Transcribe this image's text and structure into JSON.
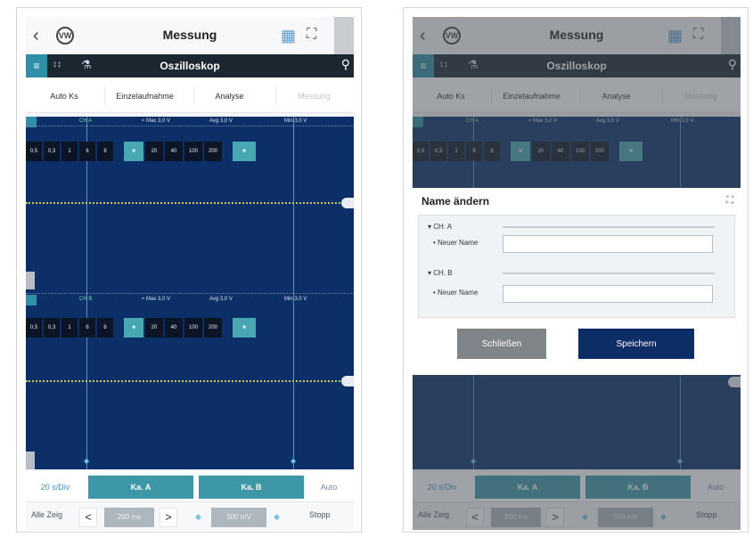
{
  "title": "Messung",
  "toolbar": {
    "title": "Oszilloskop",
    "mode_label": "↕↕",
    "menu_icon": "flask-icon",
    "search_icon": "search-icon"
  },
  "function_tabs": [
    {
      "label": "Auto Ks",
      "enabled": true
    },
    {
      "label": "Einzelaufnahme",
      "enabled": true
    },
    {
      "label": "Analyse",
      "enabled": true
    },
    {
      "label": "Messung",
      "enabled": false
    }
  ],
  "scope": {
    "header_labels": [
      "CH A",
      "≈ Max 3,0 V",
      "Avg 3,0 V",
      "Min 3,0 V"
    ],
    "range_buttons": [
      "0,5",
      "0,3",
      "1",
      "6",
      "8",
      "■",
      "20",
      "40",
      "100",
      "200",
      "■"
    ],
    "header_labels_b": [
      "CH B",
      "≈ Max 3,0 V",
      "Avg 3,0 V",
      "Min 3,0 V"
    ]
  },
  "channel_row": {
    "time_label": "20 s/Div",
    "ch_a": "Ka. A",
    "ch_b": "Ka. B",
    "auto": "Auto"
  },
  "bottom_row": {
    "all_show": "Alle Zeig",
    "prev": "<",
    "next": ">",
    "value_a": "200 ms",
    "value_b": "500 mV",
    "stop": "Stopp"
  },
  "dialog": {
    "title": "Name ändern",
    "channels": [
      {
        "label": "CH. A",
        "field_label": "Neuer Name",
        "value": ""
      },
      {
        "label": "CH. B",
        "field_label": "Neuer Name",
        "value": ""
      }
    ],
    "close_label": "Schließen",
    "save_label": "Speichern"
  },
  "colors": {
    "scope_bg": "#0b2f66",
    "accent_teal": "#3d97a7",
    "toolbar_bg": "#1d2731",
    "save_bg": "#0c2d66"
  }
}
